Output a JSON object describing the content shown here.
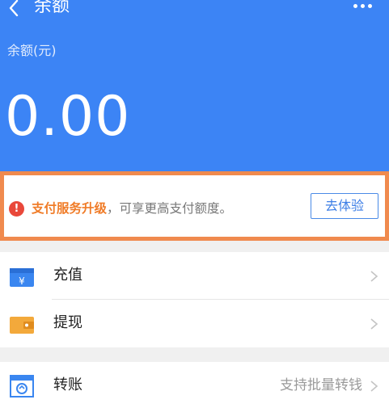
{
  "header": {
    "title": "余额",
    "back_icon": "chevron-left-icon",
    "more_icon": "more-dots-icon",
    "bg_color": "#3c84f5",
    "balance_label": "余额(元)",
    "balance_amount": "0.00"
  },
  "notice": {
    "icon": "warning-circle-icon",
    "highlight": "支付服务升级",
    "rest": "，可享更高支付额度。",
    "button_label": "去体验",
    "highlight_color": "#f07c28",
    "border_color": "#f08a4e"
  },
  "menu": {
    "items": [
      {
        "label": "充值",
        "icon": "recharge-card-icon",
        "note": ""
      },
      {
        "label": "提现",
        "icon": "wallet-icon",
        "note": ""
      }
    ],
    "transfer": {
      "label": "转账",
      "icon": "transfer-shop-icon",
      "note": "支持批量转钱"
    }
  }
}
